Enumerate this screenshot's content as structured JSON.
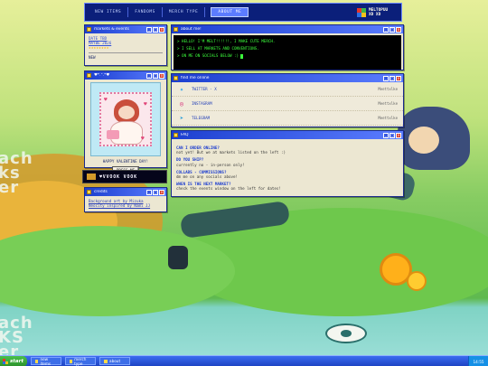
{
  "nav": {
    "items": [
      "NEW ITEMS",
      "FANDOMS",
      "MERCH TYPE",
      "ABOUT ME"
    ],
    "active_index": 3
  },
  "brand": {
    "line1": "MELTOPUU",
    "line2": "XD XD"
  },
  "wallpaper": {
    "left_text": [
      "ach",
      "ks",
      "er"
    ],
    "bottom_text": [
      "ach",
      "KS",
      "er"
    ]
  },
  "markets_window": {
    "title": "markets & events",
    "date_lines": [
      "DATE TBD",
      "MAYBE 2026"
    ],
    "stars": "★★★★★★★★",
    "status": "NEW"
  },
  "about_window": {
    "title": "about me!",
    "lines": [
      "> HELLO! I'M MELT!!!!!!, I MAKE CUTE MERCH.",
      "> I SELL AT MARKETS AND CONVENTIONS.",
      "> ON ME ON SOCIALS BELOW  :)"
    ]
  },
  "valentine_window": {
    "title": "♥*.°.*♥",
    "caption": "HAPPY VALENTINE DAY!",
    "button": "PRESS ME"
  },
  "banner": {
    "text": "♥VVOOK VOOK"
  },
  "credits_window": {
    "title": "credits",
    "lines": [
      "Background art by Mizuka",
      "Neocity inspired by Nami JJ"
    ]
  },
  "social_window": {
    "title": "find me online",
    "items": [
      {
        "icon": "twitter-icon",
        "glyph": "🐦",
        "name": "TWITTER - X",
        "action": "Meettxlke"
      },
      {
        "icon": "instagram-icon",
        "glyph": "📷",
        "name": "INSTAGRAM",
        "action": "Meettxlke"
      },
      {
        "icon": "telegram-icon",
        "glyph": "💬",
        "name": "TELEGRAM",
        "action": "Meettxlke"
      }
    ]
  },
  "faq_window": {
    "title": "FAQ",
    "items": [
      {
        "q": "CAN I ORDER ONLINE?",
        "a": "not yet! But we at markets listed on the left :)"
      },
      {
        "q": "DO YOU SHIP?",
        "a": "currently no - in-person only!"
      },
      {
        "q": "COLLABS - COMMISSIONS?",
        "a": "dm me on any socials above!"
      },
      {
        "q": "WHEN IS THE NEXT MARKET?",
        "a": "check the events window on the left for dates!"
      }
    ]
  },
  "taskbar": {
    "start": "start",
    "buttons": [
      "new items",
      "merch type",
      "about"
    ],
    "clock": "14:55"
  },
  "colors": {
    "titlebar": "#1c3fcf",
    "nav_bg": "#0b1f7a",
    "terminal_text": "#3cff3c",
    "faq_question": "#1f3fcf",
    "taskbar": "#1e44c4"
  }
}
